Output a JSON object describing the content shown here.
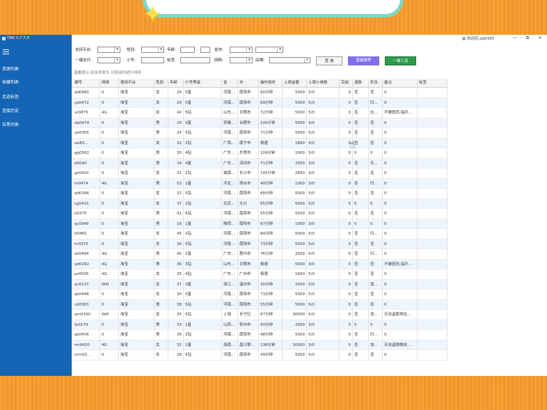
{
  "app": {
    "title": "TBB 3.7.7.0"
  },
  "user": {
    "label": "欢迎您,qd0395"
  },
  "window_buttons": [
    "—",
    "⧉",
    "✕"
  ],
  "sidebar": {
    "items": [
      {
        "label": "资源列表"
      },
      {
        "label": "收藏列表"
      },
      {
        "label": "足迹标签"
      },
      {
        "label": "连接历史"
      },
      {
        "label": "拉黑列表"
      }
    ]
  },
  "filters": {
    "platform_label": "支持平台:",
    "gender_label": "性别:",
    "age_label": "年龄:",
    "age_sep": "-",
    "province_label": "省市:",
    "payment_label": "一键支付:",
    "small_label": "小号:",
    "tag_label": "标签:",
    "history_label": "回购:",
    "shop_label": "店铺:"
  },
  "buttons": {
    "query": "查 询",
    "smart": "智能推荐",
    "onekey": "一键三连"
  },
  "hint": "温馨提示:双击列表头,可按该列进行排序",
  "table": {
    "columns": [
      "编号",
      "网络",
      "使用平台",
      "性别",
      "年龄",
      "小号等级",
      "省",
      "市",
      "操作用时",
      "上周金额",
      "上周小单数",
      "完结",
      "退款",
      "秒杀",
      "备注",
      "标签"
    ],
    "rows": [
      [
        "qd0482",
        "0",
        "淘宝",
        "女",
        "26",
        "5星",
        "河南...",
        "南阳市",
        "60分钟",
        "5000",
        "5/0",
        "0",
        "否",
        "否",
        "0",
        ""
      ],
      [
        "yp0472",
        "0",
        "淘宝",
        "女",
        "20",
        "5星",
        "河南...",
        "南阳市",
        "69分钟",
        "5000",
        "5/0",
        "0",
        "否",
        "归...",
        "0",
        ""
      ],
      [
        "xr0875",
        "4G",
        "淘宝",
        "女",
        "42",
        "5钻",
        "山东...",
        "日照市",
        "72分钟",
        "5000",
        "5/0",
        "0",
        "否",
        "比...",
        "不做医药,指针...",
        ""
      ],
      [
        "dp0474",
        "0",
        "淘宝",
        "男",
        "20",
        "3星",
        "安徽...",
        "合肥市",
        "100分钟",
        "5000",
        "3/0",
        "0",
        "否",
        "否",
        "0",
        ""
      ],
      [
        "yp0365",
        "0",
        "淘宝",
        "男",
        "24",
        "5钻",
        "河南...",
        "南阳市",
        "71分钟",
        "5000",
        "5/0",
        "0",
        "否",
        "否",
        "0",
        ""
      ],
      [
        "sw83...",
        "0",
        "淘宝",
        "女",
        "32",
        "2钻",
        "广西...",
        "南宁市",
        "极速",
        "1800",
        "3/0",
        "0",
        "否",
        "否",
        "0",
        ""
      ],
      [
        "gg0562",
        "0",
        "淘宝",
        "男",
        "30",
        "4钻",
        "广东...",
        "东莞市",
        "109分钟",
        "1000",
        "5/0",
        "0",
        "0",
        "0",
        "0",
        ""
      ],
      [
        "jt0040",
        "0",
        "淘宝",
        "男",
        "34",
        "4星",
        "广东...",
        "深圳市",
        "71分钟",
        "2000",
        "3/0",
        "0",
        "否",
        "无...",
        "0",
        ""
      ],
      [
        "gz0410",
        "0",
        "淘宝",
        "女",
        "31",
        "2钻",
        "湖南...",
        "长沙市",
        "145分钟",
        "2800",
        "3/0",
        "0",
        "否",
        "否",
        "0",
        ""
      ],
      [
        "hr0474",
        "4G",
        "淘宝",
        "男",
        "53",
        "1星",
        "河北...",
        "邢台市",
        "49分钟",
        "1000",
        "3/0",
        "0",
        "否",
        "归...",
        "0",
        ""
      ],
      [
        "qd0396",
        "0",
        "淘宝",
        "女",
        "32",
        "5钻",
        "河南...",
        "南阳市",
        "68分钟",
        "5000",
        "5/0",
        "0",
        "否",
        "否",
        "0",
        ""
      ],
      [
        "cg0415",
        "0",
        "淘宝",
        "女",
        "37",
        "1钻",
        "北京...",
        "大兴",
        "65分钟",
        "5000",
        "5/0",
        "0",
        "0",
        "0",
        "0",
        ""
      ],
      [
        "jt0375",
        "0",
        "淘宝",
        "男",
        "41",
        "5钻",
        "河南...",
        "南阳市",
        "55分钟",
        "5000",
        "5/0",
        "0",
        "否",
        "否",
        "0",
        ""
      ],
      [
        "qc0349",
        "0",
        "淘宝",
        "男",
        "16",
        "1星",
        "陕西...",
        "南阳市",
        "67分钟",
        "1000",
        "3/0",
        "0",
        "0",
        "0",
        "0",
        ""
      ],
      [
        "jt0482",
        "0",
        "淘宝",
        "女",
        "45",
        "2钻",
        "河南...",
        "南阳市",
        "84分钟",
        "5000",
        "5/0",
        "0",
        "否",
        "归...",
        "0",
        ""
      ],
      [
        "hr0375",
        "0",
        "淘宝",
        "女",
        "30",
        "5钻",
        "河南...",
        "南阳市",
        "73分钟",
        "5000",
        "5/0",
        "0",
        "否",
        "否",
        "0",
        ""
      ],
      [
        "dz0494",
        "4G",
        "淘宝",
        "男",
        "45",
        "1星",
        "广东...",
        "惠州市",
        "76分钟",
        "2000",
        "5/0",
        "0",
        "否",
        "归...",
        "0",
        ""
      ],
      [
        "qd0292",
        "4G",
        "淘宝",
        "男",
        "36",
        "3钻",
        "山东...",
        "日照市",
        "极速",
        "5000",
        "3/0",
        "0",
        "否",
        "否",
        "不做医药,指针...",
        ""
      ],
      [
        "pz0505",
        "4G",
        "淘宝",
        "女",
        "35",
        "4钻",
        "广东...",
        "广州市",
        "极速",
        "1600",
        "5/0",
        "0",
        "否",
        "否",
        "0",
        ""
      ],
      [
        "qc0137",
        "Wifi",
        "淘宝",
        "女",
        "37",
        "3星",
        "浙江...",
        "温州市",
        "30分钟",
        "2000",
        "5/0",
        "0",
        "否",
        "加...",
        "0",
        ""
      ],
      [
        "qk0448",
        "0",
        "淘宝",
        "女",
        "20",
        "5星",
        "河南...",
        "南阳市",
        "73分钟",
        "5000",
        "5/0",
        "0",
        "否",
        "否",
        "0",
        ""
      ],
      [
        "cd0363",
        "0",
        "淘宝",
        "男",
        "38",
        "5钻",
        "河南...",
        "南阳市",
        "55分钟",
        "5000",
        "5/0",
        "0",
        "否",
        "否",
        "0",
        ""
      ],
      [
        "qm0330",
        "Wifi",
        "淘宝",
        "女",
        "35",
        "5钻",
        "上海",
        "长宁区",
        "67分钟",
        "30000",
        "5/0",
        "0",
        "否",
        "加...",
        "无法盗款地址...",
        ""
      ],
      [
        "fp0179",
        "0",
        "淘宝",
        "男",
        "33",
        "1星",
        "山西...",
        "忻州市",
        "50分钟",
        "2000",
        "3/0",
        "0",
        "0",
        "0",
        "0",
        ""
      ],
      [
        "qk0436",
        "0",
        "淘宝",
        "男",
        "35",
        "2钻",
        "河南...",
        "南阳市",
        "48分钟",
        "5000",
        "5/0",
        "0",
        "否",
        "归...",
        "0",
        ""
      ],
      [
        "mr0410",
        "4G",
        "淘宝",
        "女",
        "32",
        "1星",
        "海南...",
        "昌江黎...",
        "138分钟",
        "30000",
        "3/0",
        "0",
        "否",
        "加...",
        "无法盗款微信...",
        ""
      ],
      [
        "mm03...",
        "0",
        "淘宝",
        "女",
        "28",
        "5钻",
        "河南...",
        "南阳市",
        "49分钟",
        "5000",
        "5/0",
        "0",
        "否",
        "否",
        "0",
        ""
      ]
    ]
  }
}
